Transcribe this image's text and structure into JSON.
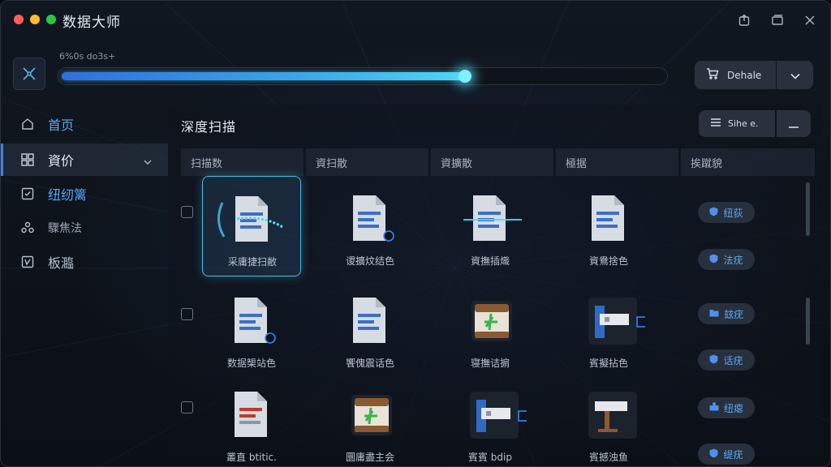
{
  "app": {
    "title": "数据大师"
  },
  "progress": {
    "label": "6%0s do3s+",
    "fraction": 0.67
  },
  "toolbar": {
    "action_label": "Dehale",
    "action_icon": "cart-icon",
    "dropdown_icon": "chevron-down-icon"
  },
  "window_controls": [
    "share-icon",
    "restore-icon",
    "close-icon"
  ],
  "sidebar": {
    "items": [
      {
        "label": "首页",
        "icon": "home-icon"
      },
      {
        "label": "資价",
        "icon": "grid-icon"
      },
      {
        "label": "纽纫篱",
        "icon": "checkbox-icon"
      },
      {
        "label": "驟焦法",
        "icon": "users-icon"
      },
      {
        "label": "板瀶",
        "icon": "document-icon"
      }
    ]
  },
  "main": {
    "title": "深度扫描",
    "sort_label": "Sihe e.",
    "columns": [
      "扫描数",
      "資扫散",
      "資擴散",
      "極据",
      "挨蹴貌"
    ],
    "rows": [
      {
        "cells": [
          {
            "label": "采庸捷扫敝",
            "icon": "scanning-file-icon",
            "highlight": true
          },
          {
            "label": "谡擴炆结色",
            "icon": "file-icon"
          },
          {
            "label": "資撫插熾",
            "icon": "scanning-file-icon"
          },
          {
            "label": "資鴦捨色",
            "icon": "file-icon"
          }
        ],
        "tags": [
          {
            "label": "纽荻",
            "icon": "shield-icon"
          },
          {
            "label": "法疣",
            "icon": "shield-icon"
          }
        ]
      },
      {
        "cells": [
          {
            "label": "数据榘站色",
            "icon": "file-icon"
          },
          {
            "label": "饗傀震话色",
            "icon": "file-icon"
          },
          {
            "label": "寝撫诘掮",
            "icon": "package-icon"
          },
          {
            "label": "賓擬拈色",
            "icon": "archive-icon"
          }
        ],
        "tags": [
          {
            "label": "玆疣",
            "icon": "folder-icon"
          },
          {
            "label": "话疣",
            "icon": "shield-icon"
          }
        ]
      },
      {
        "cells": [
          {
            "label": "叢直 btitic.",
            "icon": "pdf-file-icon"
          },
          {
            "label": "圜庸盡主会",
            "icon": "package-icon"
          },
          {
            "label": "賓賓 bdip",
            "icon": "archive-icon"
          },
          {
            "label": "賓撼浊鱼",
            "icon": "archive-icon"
          }
        ],
        "tags": [
          {
            "label": "纽瘪",
            "icon": "users-icon"
          },
          {
            "label": "缇疣",
            "icon": "shield-icon"
          }
        ]
      }
    ]
  },
  "colors": {
    "accent": "#3b82f6",
    "progress_glow": "#4fd6f5",
    "tag_text": "#5aa6f5"
  }
}
